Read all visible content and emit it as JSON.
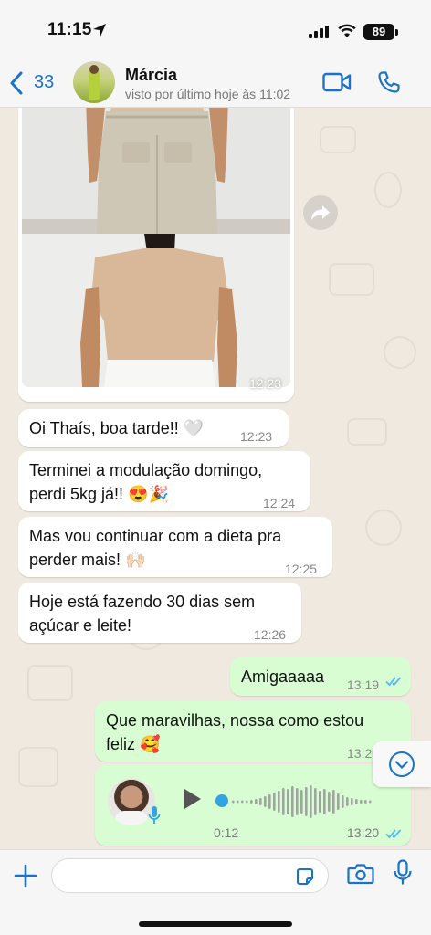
{
  "status": {
    "time": "11:15",
    "battery": "89"
  },
  "header": {
    "back_count": "33",
    "contact_name": "Márcia",
    "last_seen": "visto por último hoje às 11:02"
  },
  "messages": [
    {
      "type": "image",
      "direction": "in",
      "time": "12:23"
    },
    {
      "type": "text",
      "direction": "in",
      "text": "Oi Thaís, boa tarde!! 🤍",
      "time": "12:23"
    },
    {
      "type": "text",
      "direction": "in",
      "lines": [
        "Terminei a modulação domingo,",
        "perdi 5kg já!! 😍🎉"
      ],
      "time": "12:24"
    },
    {
      "type": "text",
      "direction": "in",
      "lines": [
        "Mas vou continuar com a dieta pra",
        "perder mais! 🙌🏻"
      ],
      "time": "12:25"
    },
    {
      "type": "text",
      "direction": "in",
      "lines": [
        "Hoje está fazendo 30 dias sem",
        "açúcar e leite!"
      ],
      "time": "12:26"
    },
    {
      "type": "text",
      "direction": "out",
      "text": "Amigaaaaa",
      "time": "13:19",
      "status": "read"
    },
    {
      "type": "text",
      "direction": "out",
      "lines": [
        "Que maravilhas, nossa como estou",
        "feliz 🥰"
      ],
      "time": "13:20",
      "status": "read"
    },
    {
      "type": "voice",
      "direction": "out",
      "duration": "0:12",
      "time": "13:20",
      "status": "read"
    }
  ],
  "colors": {
    "accent": "#1a73c9",
    "incoming_bubble": "#ffffff",
    "outgoing_bubble": "#d9fdd3",
    "read_ticks": "#53bdeb",
    "chat_background": "#efe9e0"
  },
  "icons": {
    "back": "chevron-left-icon",
    "video": "video-camera-icon",
    "call": "phone-icon",
    "forward": "forward-arrow-icon",
    "scroll_down": "chevron-down-circle-icon",
    "attach": "plus-icon",
    "sticker": "sticker-icon",
    "camera": "camera-icon",
    "mic": "microphone-icon"
  }
}
